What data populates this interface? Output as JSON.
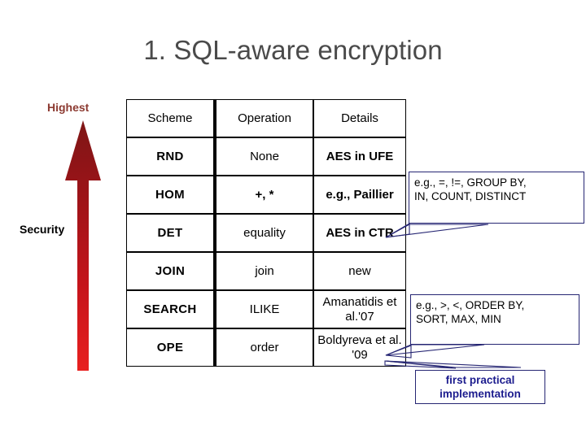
{
  "slide": {
    "title": "1. SQL-aware encryption"
  },
  "axis": {
    "top_label": "Highest",
    "side_label": "Security",
    "arrow_icon": "up-arrow-icon",
    "arrow_color_top": "#8b1a1a",
    "arrow_color_bottom": "#e01b1b"
  },
  "table": {
    "headers": [
      "Scheme",
      "Operation",
      "Details"
    ],
    "rows": [
      {
        "scheme": "RND",
        "scheme_color": "#aa3a46",
        "operation": "None",
        "details": "AES in UFE",
        "details_color": "#000000"
      },
      {
        "scheme": "HOM",
        "scheme_color": "#aa3a46",
        "operation": "+, *",
        "details": "e.g., Paillier",
        "details_color": "#000000"
      },
      {
        "scheme": "DET",
        "scheme_color": "#aa3a46",
        "operation": "equality",
        "details": "AES in CTR",
        "details_color": "#000000"
      },
      {
        "scheme": "JOIN",
        "scheme_color": "#1c1c8e",
        "operation": "join",
        "details": "new",
        "details_color": "#1c1c8e"
      },
      {
        "scheme": "SEARCH",
        "scheme_color": "#aa3a46",
        "operation": "ILIKE",
        "details": "Amanatidis et al.'07",
        "details_color": "#000000"
      },
      {
        "scheme": "OPE",
        "scheme_color": "#aa3a46",
        "operation": "order",
        "details": "Boldyreva et al. '09",
        "details_color": "#000000"
      }
    ]
  },
  "callouts": {
    "det": {
      "line1": "e.g., =, !=, GROUP BY,",
      "line2": "IN, COUNT, DISTINCT",
      "border_color": "#262673"
    },
    "ope": {
      "line1": "e.g., >, <, ORDER BY,",
      "line2": "SORT, MAX, MIN",
      "border_color": "#262673"
    },
    "first_practical": {
      "line1": "first practical",
      "line2": "implementation",
      "text_color": "#1c1c8e",
      "border_color": "#262673"
    }
  }
}
